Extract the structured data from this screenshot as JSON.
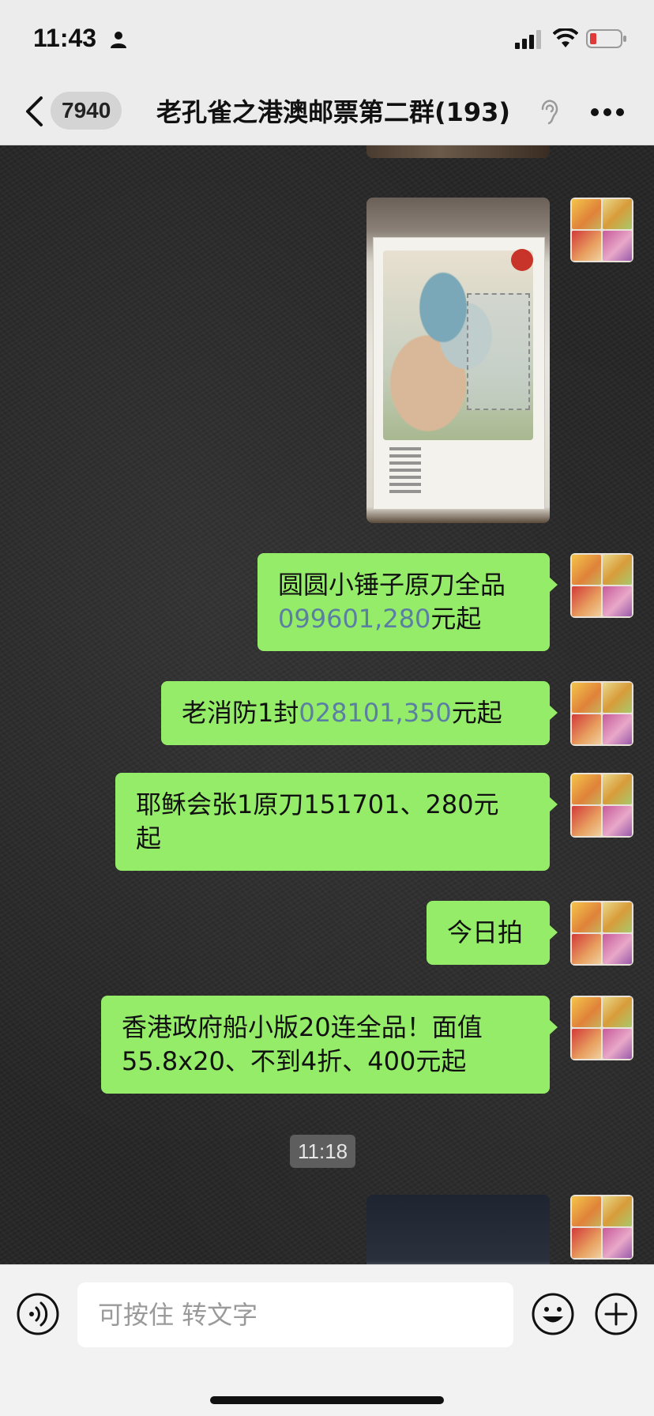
{
  "status_bar": {
    "time": "11:43"
  },
  "nav": {
    "unread_count": "7940",
    "title": "老孔雀之港澳邮票第二群(193)"
  },
  "messages": [
    {
      "type": "image",
      "description": "stamp-sheet-photo"
    },
    {
      "type": "text",
      "parts": [
        "圆圆小锤子原刀全品",
        "099601,280",
        "元起"
      ]
    },
    {
      "type": "text",
      "parts": [
        "老消防1封",
        "028101,350",
        "元起"
      ]
    },
    {
      "type": "text",
      "line1": "耶稣会张1原刀151701、280元",
      "line2": "起"
    },
    {
      "type": "text",
      "text": "今日拍"
    },
    {
      "type": "text",
      "line1": "香港政府船小版20连全品！面值",
      "line2": "55.8x20、不到4折、400元起"
    }
  ],
  "timestamp": "11:18",
  "input": {
    "placeholder": "可按住 转文字"
  },
  "colors": {
    "bubble": "#95ec69",
    "number_link": "#5b7ea3",
    "chat_background": "#262626"
  }
}
